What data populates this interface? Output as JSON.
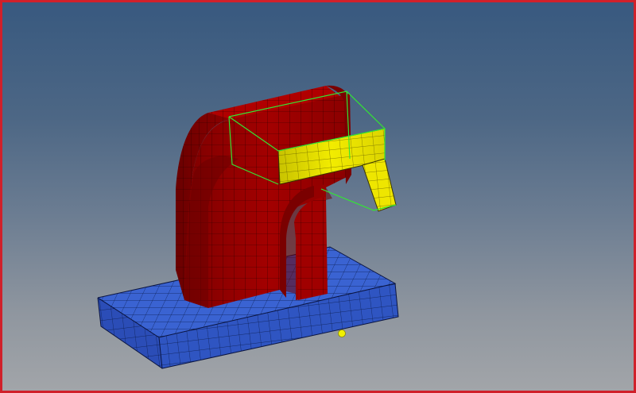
{
  "viewport": {
    "border_color": "#d0202a",
    "background_top": "#38597f",
    "background_bottom": "#a2a5a9"
  },
  "scene": {
    "base_plate": {
      "color": "#2f56c8",
      "mesh": "hex"
    },
    "arch_large": {
      "color": "#a00000",
      "mesh": "hex"
    },
    "arch_small": {
      "color": "#a00000",
      "mesh": "hex"
    },
    "yellow_bracket": {
      "color": "#e8e000",
      "mesh": "shell"
    },
    "selection_box": {
      "color": "#33e633"
    },
    "node_marker": {
      "color": "#f0f000"
    }
  }
}
